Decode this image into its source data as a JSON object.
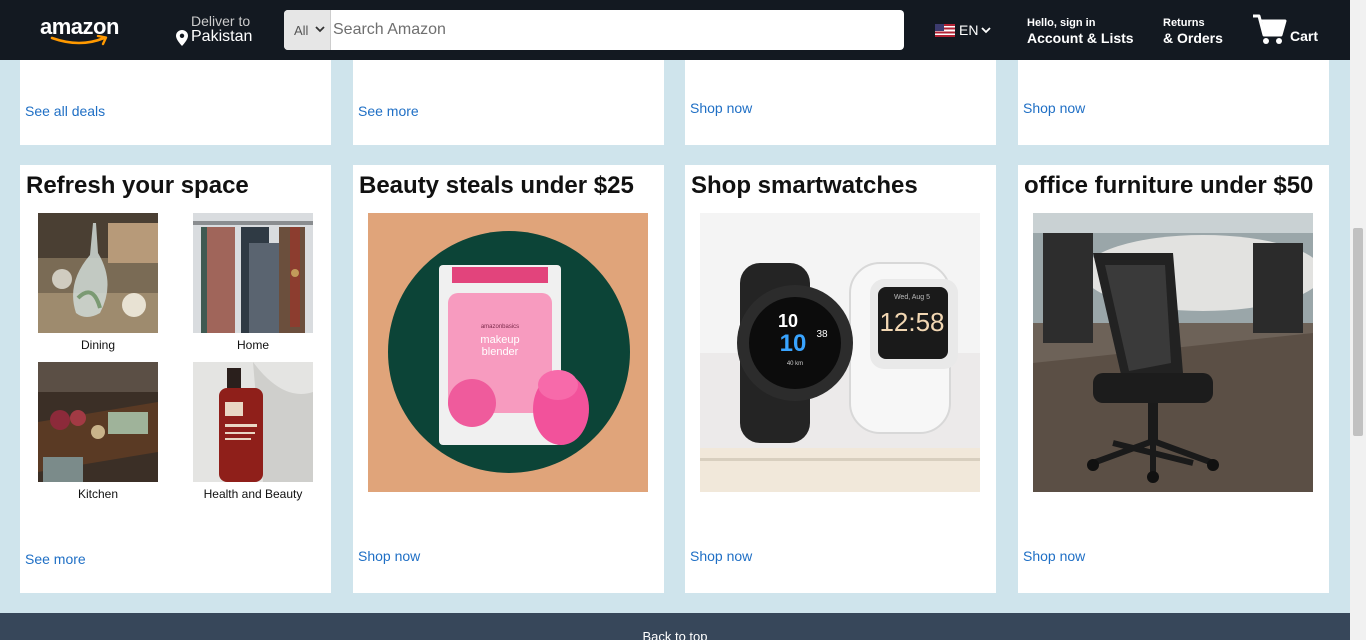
{
  "header": {
    "logo_text": "amazon",
    "deliver_line1": "Deliver to",
    "deliver_line2": "Pakistan",
    "search_category": "All",
    "search_placeholder": "Search Amazon",
    "language": "EN",
    "account_line1": "Hello, sign in",
    "account_line2": "Account & Lists",
    "returns_line1": "Returns",
    "returns_line2": "& Orders",
    "cart_label": "Cart",
    "icons": [
      "location-pin-icon",
      "chevron-down-icon",
      "search-icon",
      "us-flag-icon",
      "cart-icon"
    ]
  },
  "top_row": [
    {
      "link": "See all deals"
    },
    {
      "link": "See more"
    },
    {
      "link": "Shop now"
    },
    {
      "link": "Shop now"
    }
  ],
  "cards": [
    {
      "title": "Refresh your space",
      "tiles": [
        {
          "label": "Dining"
        },
        {
          "label": "Home"
        },
        {
          "label": "Kitchen"
        },
        {
          "label": "Health and Beauty"
        }
      ],
      "link": "See more"
    },
    {
      "title": "Beauty steals under $25",
      "image": {
        "brand": "amazonbasics",
        "product_line1": "makeup",
        "product_line2": "blender"
      },
      "link": "Shop now"
    },
    {
      "title": "Shop smartwatches",
      "image": {
        "watch1_hour": "10",
        "watch1_min": "10",
        "watch1_sec": "38",
        "watch1_sub": "40 km",
        "watch2_date": "Wed, Aug 5",
        "watch2_time": "12:58"
      },
      "link": "Shop now"
    },
    {
      "title": "office furniture under $50",
      "link": "Shop now"
    }
  ],
  "footer": {
    "back_to_top": "Back to top"
  },
  "colors": {
    "header_bg": "#131921",
    "search_button": "#febd69",
    "link": "#1f6fc5",
    "page_bg": "#cfe4ec",
    "footer_bg": "#37475a"
  }
}
